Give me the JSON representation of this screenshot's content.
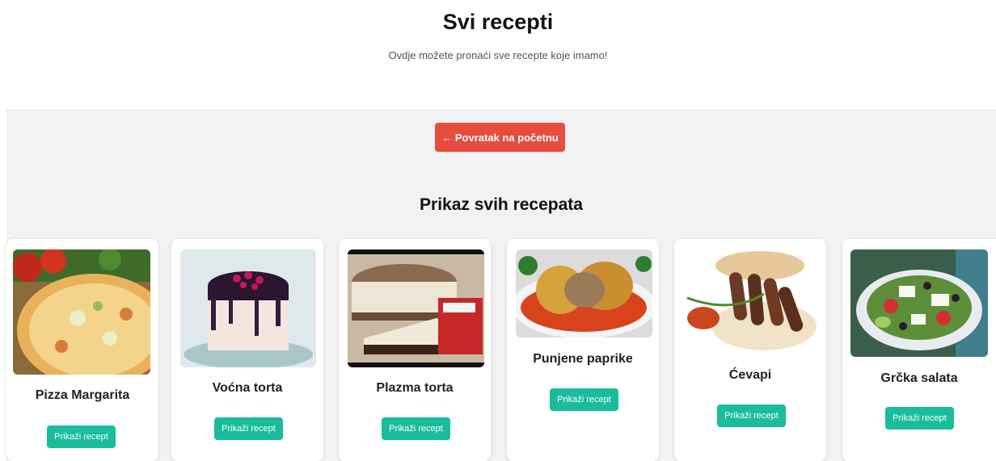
{
  "header": {
    "title": "Svi recepti",
    "subtitle": "Ovdje možete pronaći sve recepte koje imamo!"
  },
  "nav": {
    "back_label": "← Povratak na početnu"
  },
  "section": {
    "title": "Prikaz svih recepata"
  },
  "recipes": [
    {
      "name": "Pizza Margarita",
      "button": "Prikaži recept"
    },
    {
      "name": "Voćna torta",
      "button": "Prikaži recept"
    },
    {
      "name": "Plazma torta",
      "button": "Prikaži recept"
    },
    {
      "name": "Punjene paprike",
      "button": "Prikaži recept"
    },
    {
      "name": "Ćevapi",
      "button": "Prikaži recept"
    },
    {
      "name": "Grčka salata",
      "button": "Prikaži recept"
    }
  ],
  "colors": {
    "back_button": "#e74c3c",
    "recipe_button": "#1abc9c",
    "content_bg": "#f2f2f2"
  }
}
